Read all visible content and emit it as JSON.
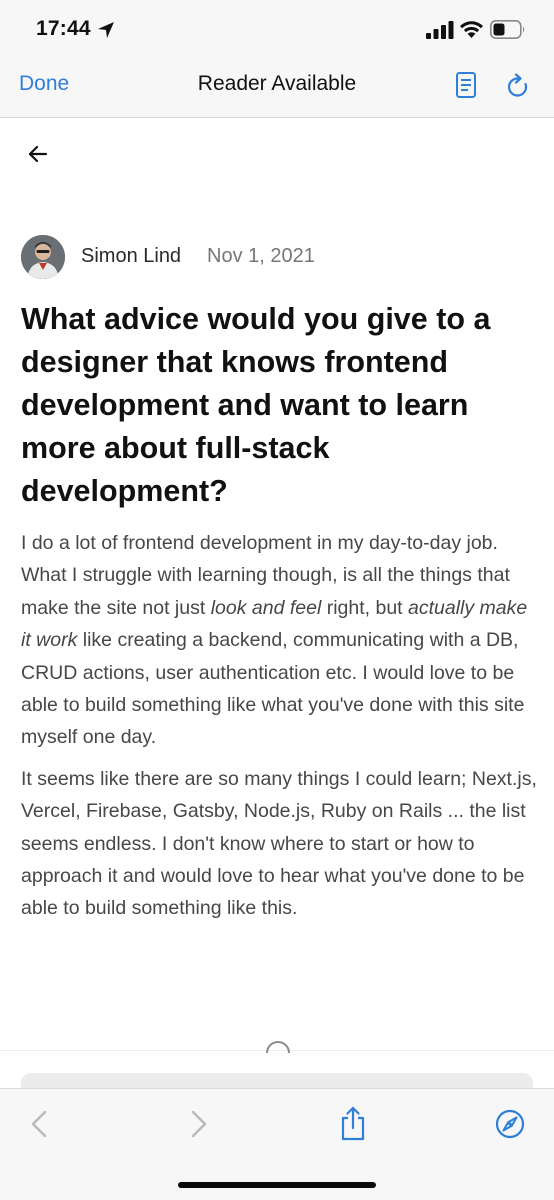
{
  "status_bar": {
    "time": "17:44",
    "icons": [
      "location-arrow-icon",
      "cellular-signal-icon",
      "wifi-icon",
      "battery-icon"
    ]
  },
  "nav": {
    "done_label": "Done",
    "title": "Reader Available",
    "accent_color": "#2f7fd8",
    "icons": [
      "reader-icon",
      "reload-icon"
    ]
  },
  "post": {
    "author": "Simon Lind",
    "date": "Nov 1, 2021",
    "title": "What advice would you give to a designer that knows frontend development and want to learn more about full-stack development?",
    "body_p1_a": "I do a lot of frontend development in my day-to-day job. What I struggle with learning though, is all the things that make the site not just ",
    "body_p1_em1": "look and feel",
    "body_p1_b": " right, but ",
    "body_p1_em2": "actually make it work",
    "body_p1_c": " like creating a backend, communicating with a DB, CRUD actions, user authentication etc. I would love to be able to build something like what you've done with this site myself one day.",
    "body_p2": "It seems like there are so many things I could learn; Next.js, Vercel, Firebase, Gatsby, Node.js, Ruby on Rails ... the list seems endless. I don't know where to start or how to approach it and would love to hear what you've done to be able to build something like this."
  },
  "toolbar": {
    "icons": [
      "back-icon",
      "forward-icon",
      "share-icon",
      "safari-compass-icon"
    ],
    "active_color": "#2f7fd8",
    "disabled_color": "#b9b9bd"
  }
}
